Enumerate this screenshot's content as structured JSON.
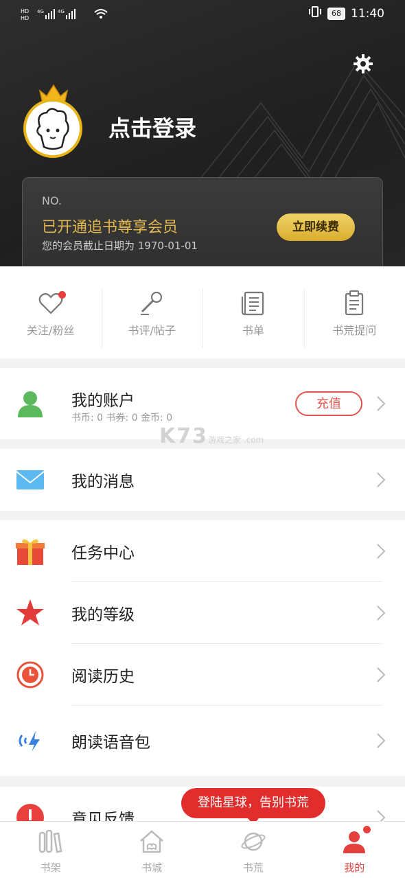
{
  "status_bar": {
    "left": "HD 4G 4G",
    "battery": "68",
    "time": "11:40"
  },
  "header": {
    "login_label": "点击登录"
  },
  "vip_card": {
    "no": "NO.",
    "title": "已开通追书尊享会员",
    "expire": "您的会员截止日期为  1970-01-01",
    "renew_label": "立即续费"
  },
  "quick_links": [
    {
      "label": "关注/粉丝",
      "icon": "heart-icon"
    },
    {
      "label": "书评/帖子",
      "icon": "microphone-icon"
    },
    {
      "label": "书单",
      "icon": "document-list-icon"
    },
    {
      "label": "书荒提问",
      "icon": "clipboard-icon"
    }
  ],
  "account": {
    "title": "我的账户",
    "stats": "书币: 0    书券: 0    金币: 0",
    "recharge_label": "充值"
  },
  "messages": {
    "title": "我的消息"
  },
  "menu": [
    {
      "label": "任务中心",
      "icon": "gift-icon"
    },
    {
      "label": "我的等级",
      "icon": "star-icon"
    },
    {
      "label": "阅读历史",
      "icon": "history-clock-icon"
    },
    {
      "label": "朗读语音包",
      "icon": "voice-icon"
    }
  ],
  "feedback": {
    "title": "意见反馈"
  },
  "bubble": "登陆星球，告别书荒",
  "watermark": {
    "main": "K73",
    "sub": "游戏之家 .com"
  },
  "tabs": [
    {
      "label": "书架",
      "icon": "bookshelf-icon"
    },
    {
      "label": "书城",
      "icon": "bookstore-icon"
    },
    {
      "label": "书荒",
      "icon": "planet-icon"
    },
    {
      "label": "我的",
      "icon": "profile-icon"
    }
  ],
  "colors": {
    "accent": "#e4403d",
    "gold": "#e2b74d"
  }
}
